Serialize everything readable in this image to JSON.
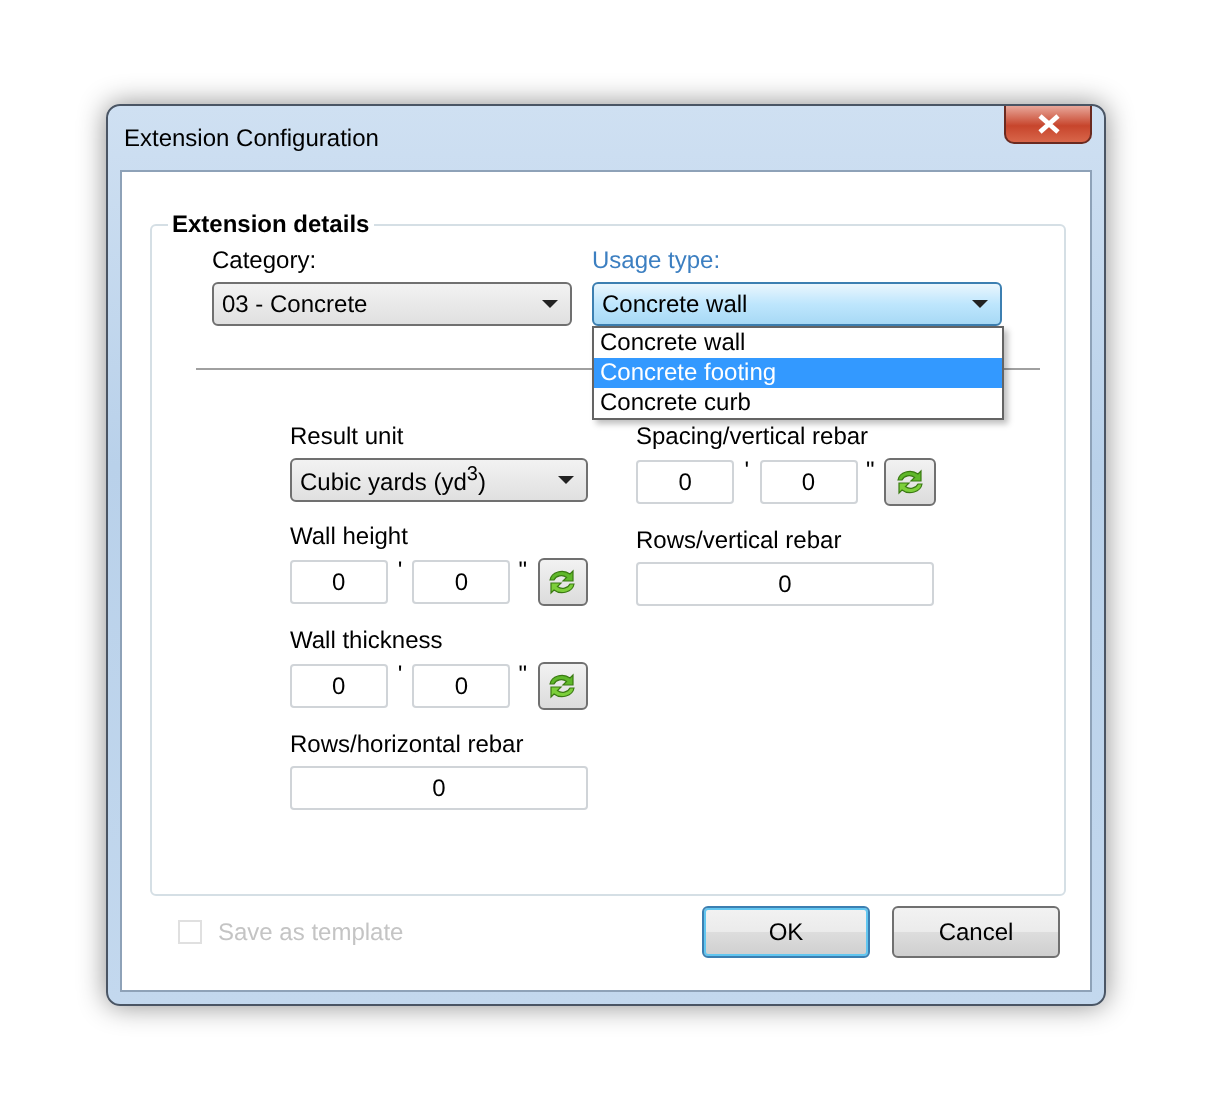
{
  "window": {
    "title": "Extension Configuration"
  },
  "group": {
    "title": "Extension details"
  },
  "category": {
    "label": "Category:",
    "value": "03 - Concrete"
  },
  "usage_type": {
    "label": "Usage type:",
    "value": "Concrete wall",
    "expanded": true,
    "options": [
      {
        "label": "Concrete wall",
        "highlighted": false
      },
      {
        "label": "Concrete footing",
        "highlighted": true
      },
      {
        "label": "Concrete curb",
        "highlighted": false
      }
    ]
  },
  "left_column": [
    {
      "kind": "dropdown",
      "label": "Result unit",
      "value": "Cubic yards (yd$^{3}$)"
    },
    {
      "kind": "feet_inches",
      "label": "Wall height",
      "feet": "0",
      "feet_mark": "'",
      "inches": "0",
      "inch_mark": "\""
    },
    {
      "kind": "feet_inches",
      "label": "Wall thickness",
      "feet": "0",
      "feet_mark": "'",
      "inches": "0",
      "inch_mark": "\""
    },
    {
      "kind": "number",
      "label": "Rows/horizontal rebar",
      "value": "0"
    }
  ],
  "right_column": [
    {
      "kind": "feet_inches",
      "label": "Spacing/vertical rebar",
      "feet": "0",
      "feet_mark": "'",
      "inches": "0",
      "inch_mark": "\""
    },
    {
      "kind": "number",
      "label": "Rows/vertical rebar",
      "value": "0"
    }
  ],
  "save_template": {
    "label": "Save as template",
    "checked": false,
    "disabled": true
  },
  "buttons": [
    {
      "label": "OK",
      "focused": true
    },
    {
      "label": "Cancel",
      "focused": false
    }
  ]
}
